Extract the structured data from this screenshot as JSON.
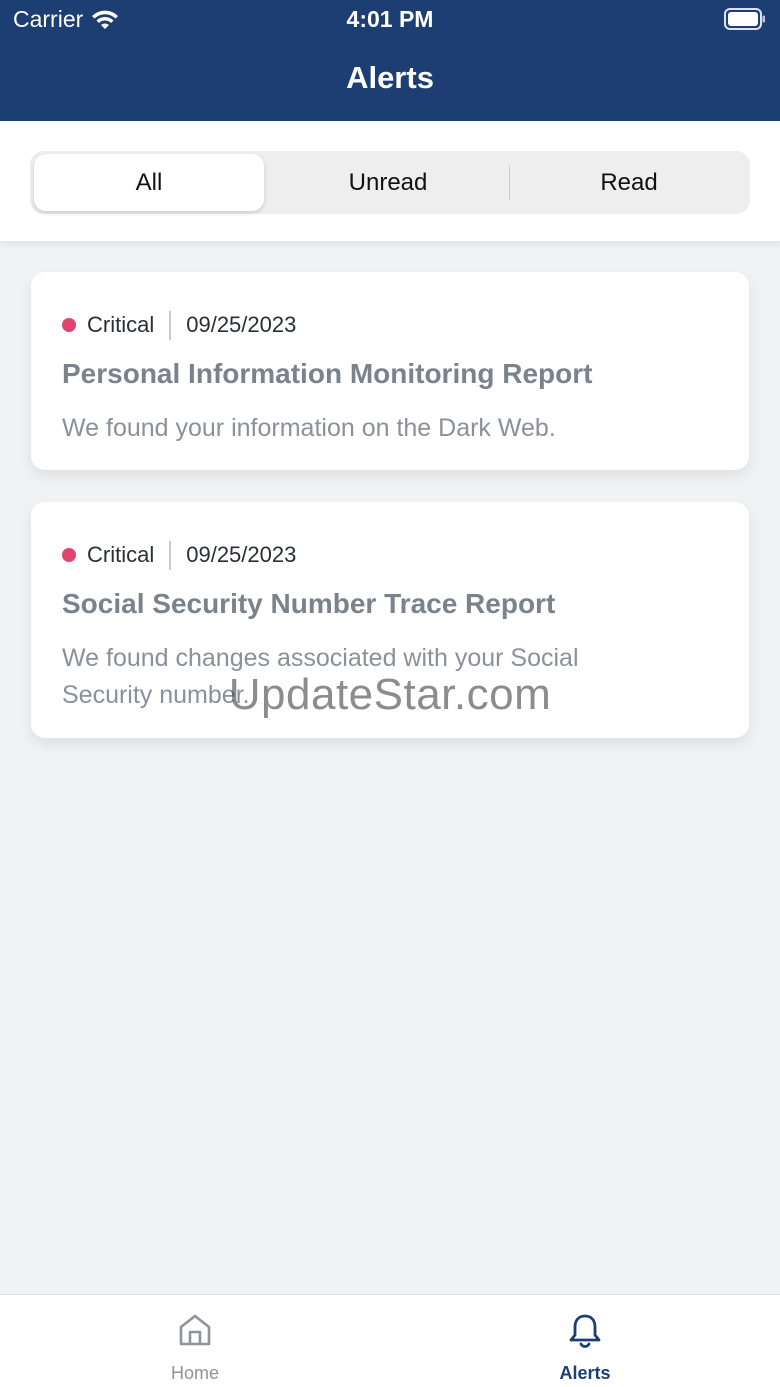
{
  "status_bar": {
    "carrier": "Carrier",
    "time": "4:01 PM",
    "icons": [
      "wifi-icon",
      "battery-icon"
    ]
  },
  "header": {
    "title": "Alerts"
  },
  "filter_tabs": [
    {
      "label": "All",
      "selected": true
    },
    {
      "label": "Unread",
      "selected": false
    },
    {
      "label": "Read",
      "selected": false
    }
  ],
  "alerts": [
    {
      "severity": "Critical",
      "severity_color": "#e0456f",
      "date": "09/25/2023",
      "title": "Personal Information Monitoring Report",
      "description": "We found your information on the Dark Web."
    },
    {
      "severity": "Critical",
      "severity_color": "#e0456f",
      "date": "09/25/2023",
      "title": "Social Security Number Trace Report",
      "description": "We found changes associated with your Social Security number."
    }
  ],
  "watermark": "UpdateStar.com",
  "tab_bar": {
    "items": [
      {
        "label": "Home",
        "icon": "home-icon",
        "active": false
      },
      {
        "label": "Alerts",
        "icon": "bell-icon",
        "active": true
      }
    ]
  },
  "colors": {
    "header_bg": "#1d3e72",
    "page_bg": "#f0f2f4",
    "active_tab": "#1d3e72",
    "inactive_tab": "#8e949b",
    "critical": "#e0456f"
  }
}
